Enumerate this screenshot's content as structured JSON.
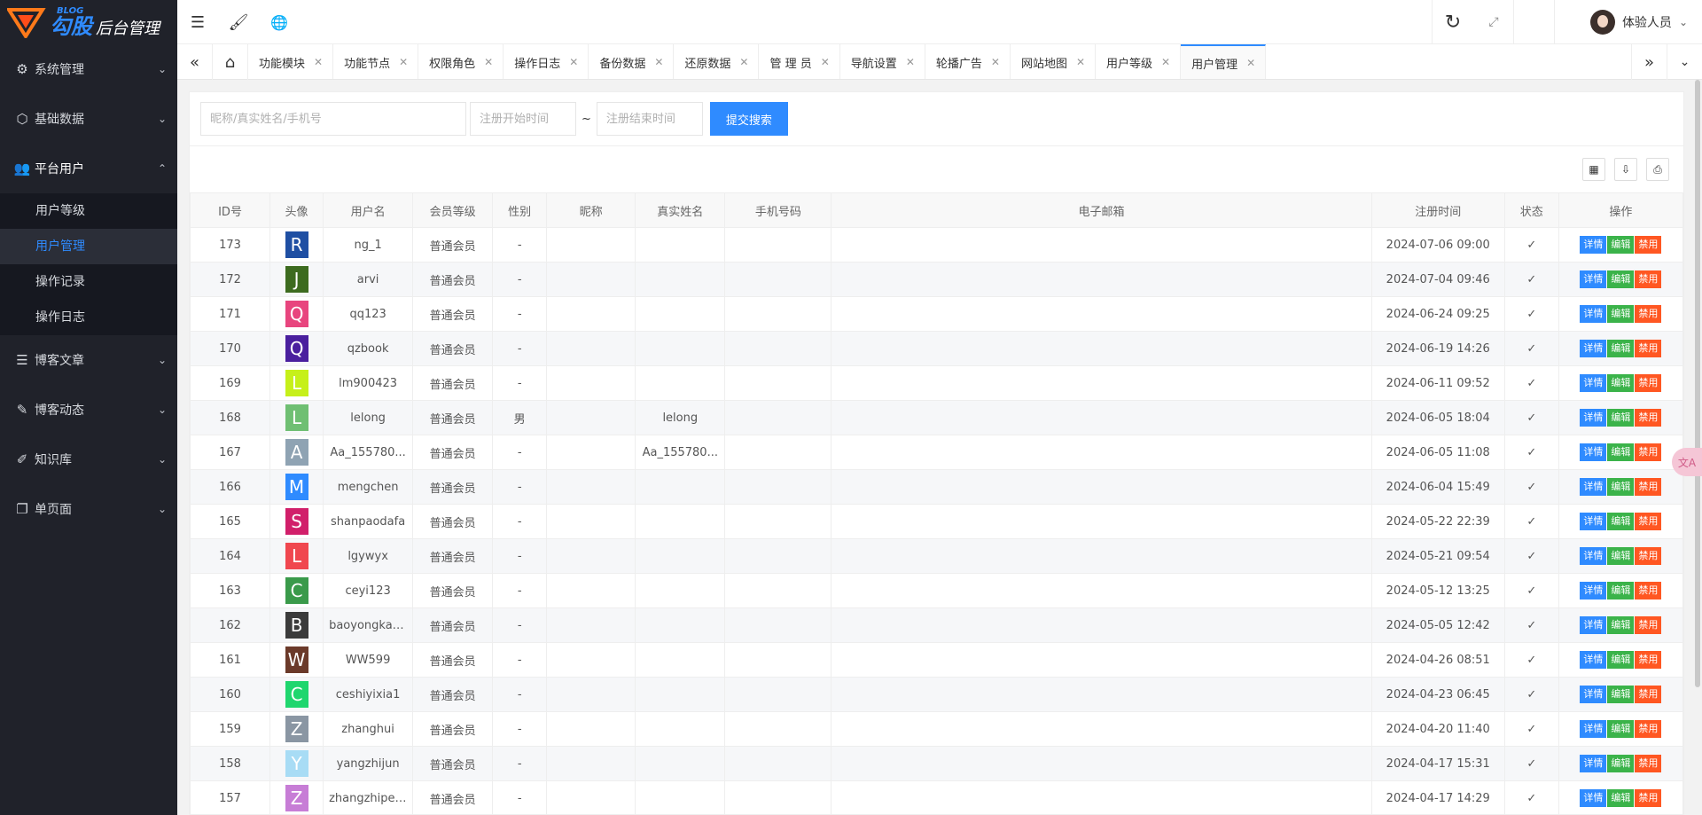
{
  "brand": {
    "blog": "BLOG",
    "name": "勾股",
    "suffix": "后台管理"
  },
  "sidebar": {
    "items": [
      {
        "label": "系统管理",
        "icon": "gear-icon",
        "glyph": "⚙",
        "arrow": "⌄"
      },
      {
        "label": "基础数据",
        "icon": "cube-icon",
        "glyph": "⬡",
        "arrow": "⌄"
      },
      {
        "label": "平台用户",
        "icon": "users-icon",
        "glyph": "👥",
        "arrow": "⌃"
      },
      {
        "label": "博客文章",
        "icon": "document-icon",
        "glyph": "☰",
        "arrow": "⌄"
      },
      {
        "label": "博客动态",
        "icon": "edit-square-icon",
        "glyph": "✎",
        "arrow": "⌄"
      },
      {
        "label": "知识库",
        "icon": "pencil-icon",
        "glyph": "✐",
        "arrow": "⌄"
      },
      {
        "label": "单页面",
        "icon": "page-icon",
        "glyph": "❐",
        "arrow": "⌄"
      }
    ],
    "subitems": [
      "用户等级",
      "用户管理",
      "操作记录",
      "操作日志"
    ]
  },
  "header": {
    "menu_glyph": "☰",
    "brush_glyph": "🖌",
    "globe_glyph": "🌐",
    "refresh_glyph": "↻",
    "fullscreen_glyph": "⤢",
    "user_name": "体验人员",
    "user_arrow": "⌄"
  },
  "tabs": {
    "prev_glyph": "«",
    "home_glyph": "⌂",
    "next_glyph": "»",
    "more_glyph": "⌄",
    "close_glyph": "✕",
    "items": [
      "功能模块",
      "功能节点",
      "权限角色",
      "操作日志",
      "备份数据",
      "还原数据",
      "管 理 员",
      "导航设置",
      "轮播广告",
      "网站地图",
      "用户等级",
      "用户管理"
    ],
    "active_index": 11
  },
  "search": {
    "keyword_placeholder": "昵称/真实姓名/手机号",
    "start_placeholder": "注册开始时间",
    "end_placeholder": "注册结束时间",
    "tilde": "~",
    "submit_label": "提交搜索"
  },
  "toolbar": {
    "columns_glyph": "▦",
    "export_glyph": "⇩",
    "print_glyph": "⎙"
  },
  "table": {
    "headers": [
      "ID号",
      "头像",
      "用户名",
      "会员等级",
      "性别",
      "昵称",
      "真实姓名",
      "手机号码",
      "电子邮箱",
      "注册时间",
      "状态",
      "操作"
    ],
    "ops": {
      "detail": "详情",
      "edit": "编辑",
      "ban": "禁用"
    },
    "check_glyph": "✓",
    "rows": [
      {
        "id": "173",
        "letter": "R",
        "color": "#1f4fa3",
        "username": "ng_1",
        "level": "普通会员",
        "gender": "-",
        "nickname": "",
        "realname": "",
        "phone": "",
        "email": "",
        "time": "2024-07-06 09:00"
      },
      {
        "id": "172",
        "letter": "J",
        "color": "#3d6b1f",
        "username": "arvi",
        "level": "普通会员",
        "gender": "-",
        "nickname": "",
        "realname": "",
        "phone": "",
        "email": "",
        "time": "2024-07-04 09:46"
      },
      {
        "id": "171",
        "letter": "Q",
        "color": "#e8457e",
        "username": "qq123",
        "level": "普通会员",
        "gender": "-",
        "nickname": "",
        "realname": "",
        "phone": "",
        "email": "",
        "time": "2024-06-24 09:25"
      },
      {
        "id": "170",
        "letter": "Q",
        "color": "#4a1f9e",
        "username": "qzbook",
        "level": "普通会员",
        "gender": "-",
        "nickname": "",
        "realname": "",
        "phone": "",
        "email": "",
        "time": "2024-06-19 14:26"
      },
      {
        "id": "169",
        "letter": "L",
        "color": "#c6f01a",
        "username": "lm900423",
        "level": "普通会员",
        "gender": "-",
        "nickname": "",
        "realname": "",
        "phone": "",
        "email": "",
        "time": "2024-06-11 09:52"
      },
      {
        "id": "168",
        "letter": "L",
        "color": "#6fbf73",
        "username": "lelong",
        "level": "普通会员",
        "gender": "男",
        "nickname": "",
        "realname": "lelong",
        "phone": "",
        "email": "",
        "time": "2024-06-05 18:04"
      },
      {
        "id": "167",
        "letter": "A",
        "color": "#8fa3b3",
        "username": "Aa_155780...",
        "level": "普通会员",
        "gender": "-",
        "nickname": "",
        "realname": "Aa_155780...",
        "phone": "",
        "email": "",
        "time": "2024-06-05 11:08"
      },
      {
        "id": "166",
        "letter": "M",
        "color": "#2f8bff",
        "username": "mengchen",
        "level": "普通会员",
        "gender": "-",
        "nickname": "",
        "realname": "",
        "phone": "",
        "email": "",
        "time": "2024-06-04 15:49"
      },
      {
        "id": "165",
        "letter": "S",
        "color": "#d11f6a",
        "username": "shanpaodafa",
        "level": "普通会员",
        "gender": "-",
        "nickname": "",
        "realname": "",
        "phone": "",
        "email": "",
        "time": "2024-05-22 22:39"
      },
      {
        "id": "164",
        "letter": "L",
        "color": "#f0474f",
        "username": "lgywyx",
        "level": "普通会员",
        "gender": "-",
        "nickname": "",
        "realname": "",
        "phone": "",
        "email": "",
        "time": "2024-05-21 09:54"
      },
      {
        "id": "163",
        "letter": "C",
        "color": "#3a9a4a",
        "username": "ceyi123",
        "level": "普通会员",
        "gender": "-",
        "nickname": "",
        "realname": "",
        "phone": "",
        "email": "",
        "time": "2024-05-12 13:25"
      },
      {
        "id": "162",
        "letter": "B",
        "color": "#3b3b3b",
        "username": "baoyongkang",
        "level": "普通会员",
        "gender": "-",
        "nickname": "",
        "realname": "",
        "phone": "",
        "email": "",
        "time": "2024-05-05 12:42"
      },
      {
        "id": "161",
        "letter": "W",
        "color": "#6b3a2a",
        "username": "WW599",
        "level": "普通会员",
        "gender": "-",
        "nickname": "",
        "realname": "",
        "phone": "",
        "email": "",
        "time": "2024-04-26 08:51"
      },
      {
        "id": "160",
        "letter": "C",
        "color": "#1fd66e",
        "username": "ceshiyixia1",
        "level": "普通会员",
        "gender": "-",
        "nickname": "",
        "realname": "",
        "phone": "",
        "email": "",
        "time": "2024-04-23 06:45"
      },
      {
        "id": "159",
        "letter": "Z",
        "color": "#8a96a3",
        "username": "zhanghui",
        "level": "普通会员",
        "gender": "-",
        "nickname": "",
        "realname": "",
        "phone": "",
        "email": "",
        "time": "2024-04-20 11:40"
      },
      {
        "id": "158",
        "letter": "Y",
        "color": "#a8dcf5",
        "username": "yangzhijun",
        "level": "普通会员",
        "gender": "-",
        "nickname": "",
        "realname": "",
        "phone": "",
        "email": "",
        "time": "2024-04-17 15:31"
      },
      {
        "id": "157",
        "letter": "Z",
        "color": "#c77dd6",
        "username": "zhangzhipeng",
        "level": "普通会员",
        "gender": "-",
        "nickname": "",
        "realname": "",
        "phone": "",
        "email": "",
        "time": "2024-04-17 14:29"
      }
    ]
  },
  "float_button": {
    "label": "文A"
  }
}
